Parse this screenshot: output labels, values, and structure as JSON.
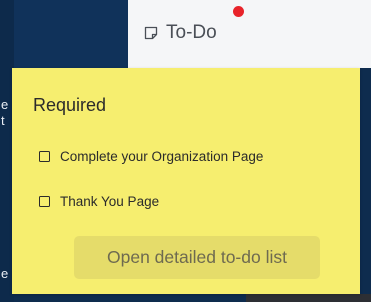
{
  "header": {
    "todo_tab_label": "To-Do",
    "todo_tab_icon": "sticky-note-icon",
    "notification_color": "#e8232a"
  },
  "background_edge_text": [
    "e",
    "t",
    "e"
  ],
  "todo_popover": {
    "title": "Required",
    "items": [
      {
        "label": "Complete your Organization Page",
        "checked": false
      },
      {
        "label": "Thank You Page",
        "checked": false
      }
    ],
    "open_button_label": "Open detailed to-do list",
    "background_color": "#f6ee6f"
  }
}
